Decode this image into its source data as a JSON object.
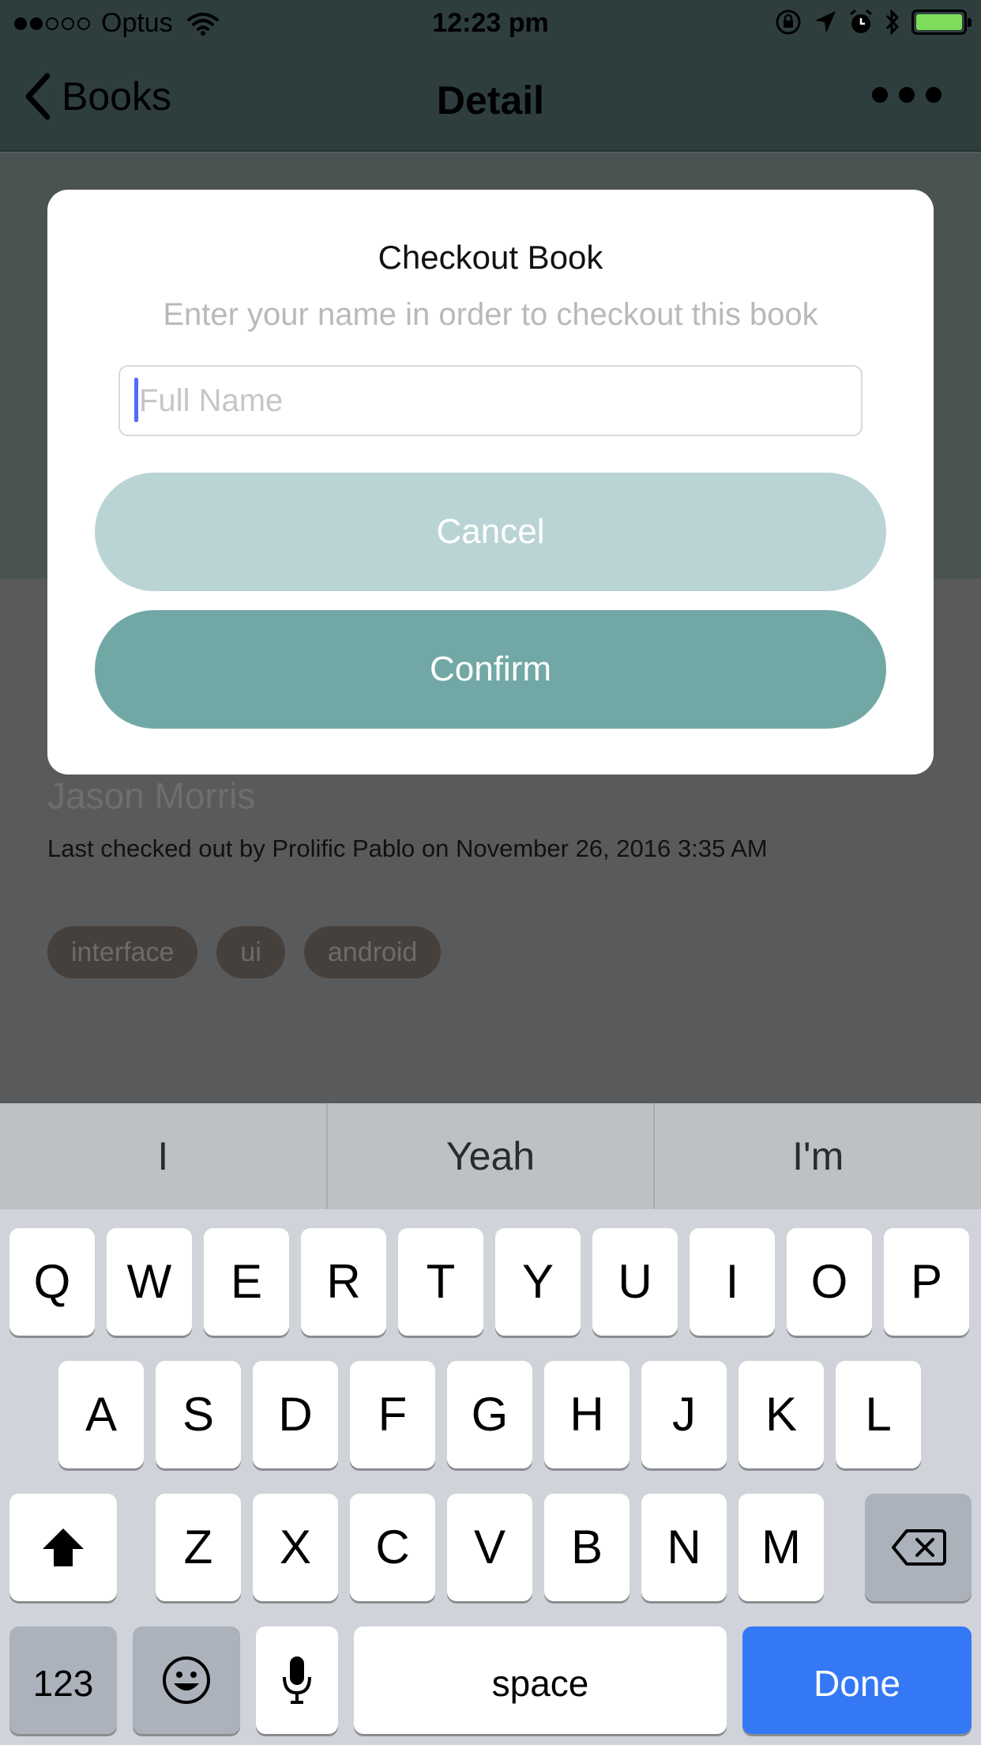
{
  "status_bar": {
    "carrier": "Optus",
    "time": "12:23 pm",
    "signal_dots_filled": 2,
    "signal_dots_total": 5,
    "battery_level": 1.0,
    "battery_color": "#7ddc5a",
    "icons": [
      "wifi-icon",
      "rotation-lock-icon",
      "location-arrow-icon",
      "alarm-icon",
      "bluetooth-icon",
      "battery-icon"
    ]
  },
  "nav": {
    "back_label": "Books",
    "title": "Detail",
    "more_icon": "ellipsis-icon"
  },
  "page": {
    "author": "Jason Morris",
    "last_checkout": "Last checked out by Prolific Pablo on November 26, 2016 3:35 AM",
    "tags": [
      "interface",
      "ui",
      "android"
    ]
  },
  "modal": {
    "title": "Checkout Book",
    "subtitle": "Enter your name in order to checkout this book",
    "name_placeholder": "Full Name",
    "name_value": "",
    "cancel_label": "Cancel",
    "confirm_label": "Confirm",
    "cancel_color": "#bad4d5",
    "confirm_color": "#71a8a5"
  },
  "keyboard": {
    "suggestions": [
      "I",
      "Yeah",
      "I'm"
    ],
    "row1": [
      "Q",
      "W",
      "E",
      "R",
      "T",
      "Y",
      "U",
      "I",
      "O",
      "P"
    ],
    "row2": [
      "A",
      "S",
      "D",
      "F",
      "G",
      "H",
      "J",
      "K",
      "L"
    ],
    "row3": [
      "Z",
      "X",
      "C",
      "V",
      "B",
      "N",
      "M"
    ],
    "numbers_label": "123",
    "space_label": "space",
    "done_label": "Done",
    "done_color": "#3478f6"
  }
}
